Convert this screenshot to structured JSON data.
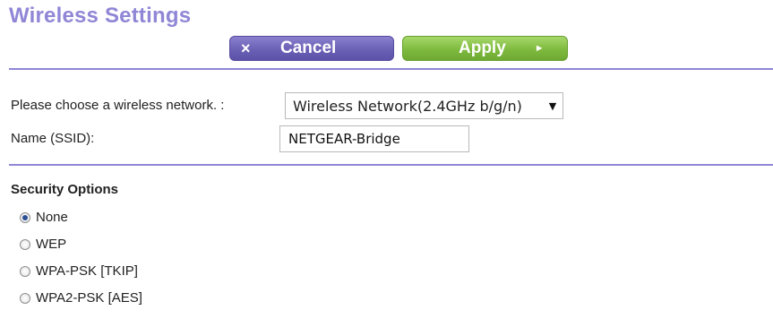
{
  "header": {
    "title": "Wireless Settings"
  },
  "toolbar": {
    "cancel_label": "Cancel",
    "cancel_icon_glyph": "×",
    "apply_label": "Apply",
    "apply_icon_glyph": "►"
  },
  "network": {
    "choose_label": "Please choose a wireless network. :",
    "selected_network": "Wireless Network(2.4GHz b/g/n)",
    "ssid_label": "Name (SSID):",
    "ssid_value": "NETGEAR-Bridge"
  },
  "security": {
    "title": "Security Options",
    "options": [
      {
        "label": "None",
        "checked": true
      },
      {
        "label": "WEP",
        "checked": false
      },
      {
        "label": "WPA-PSK [TKIP]",
        "checked": false
      },
      {
        "label": "WPA2-PSK [AES]",
        "checked": false
      }
    ]
  },
  "colors": {
    "title_purple": "#8f86d6",
    "cancel_purple": "#6a60b5",
    "apply_green": "#7fba3f"
  }
}
